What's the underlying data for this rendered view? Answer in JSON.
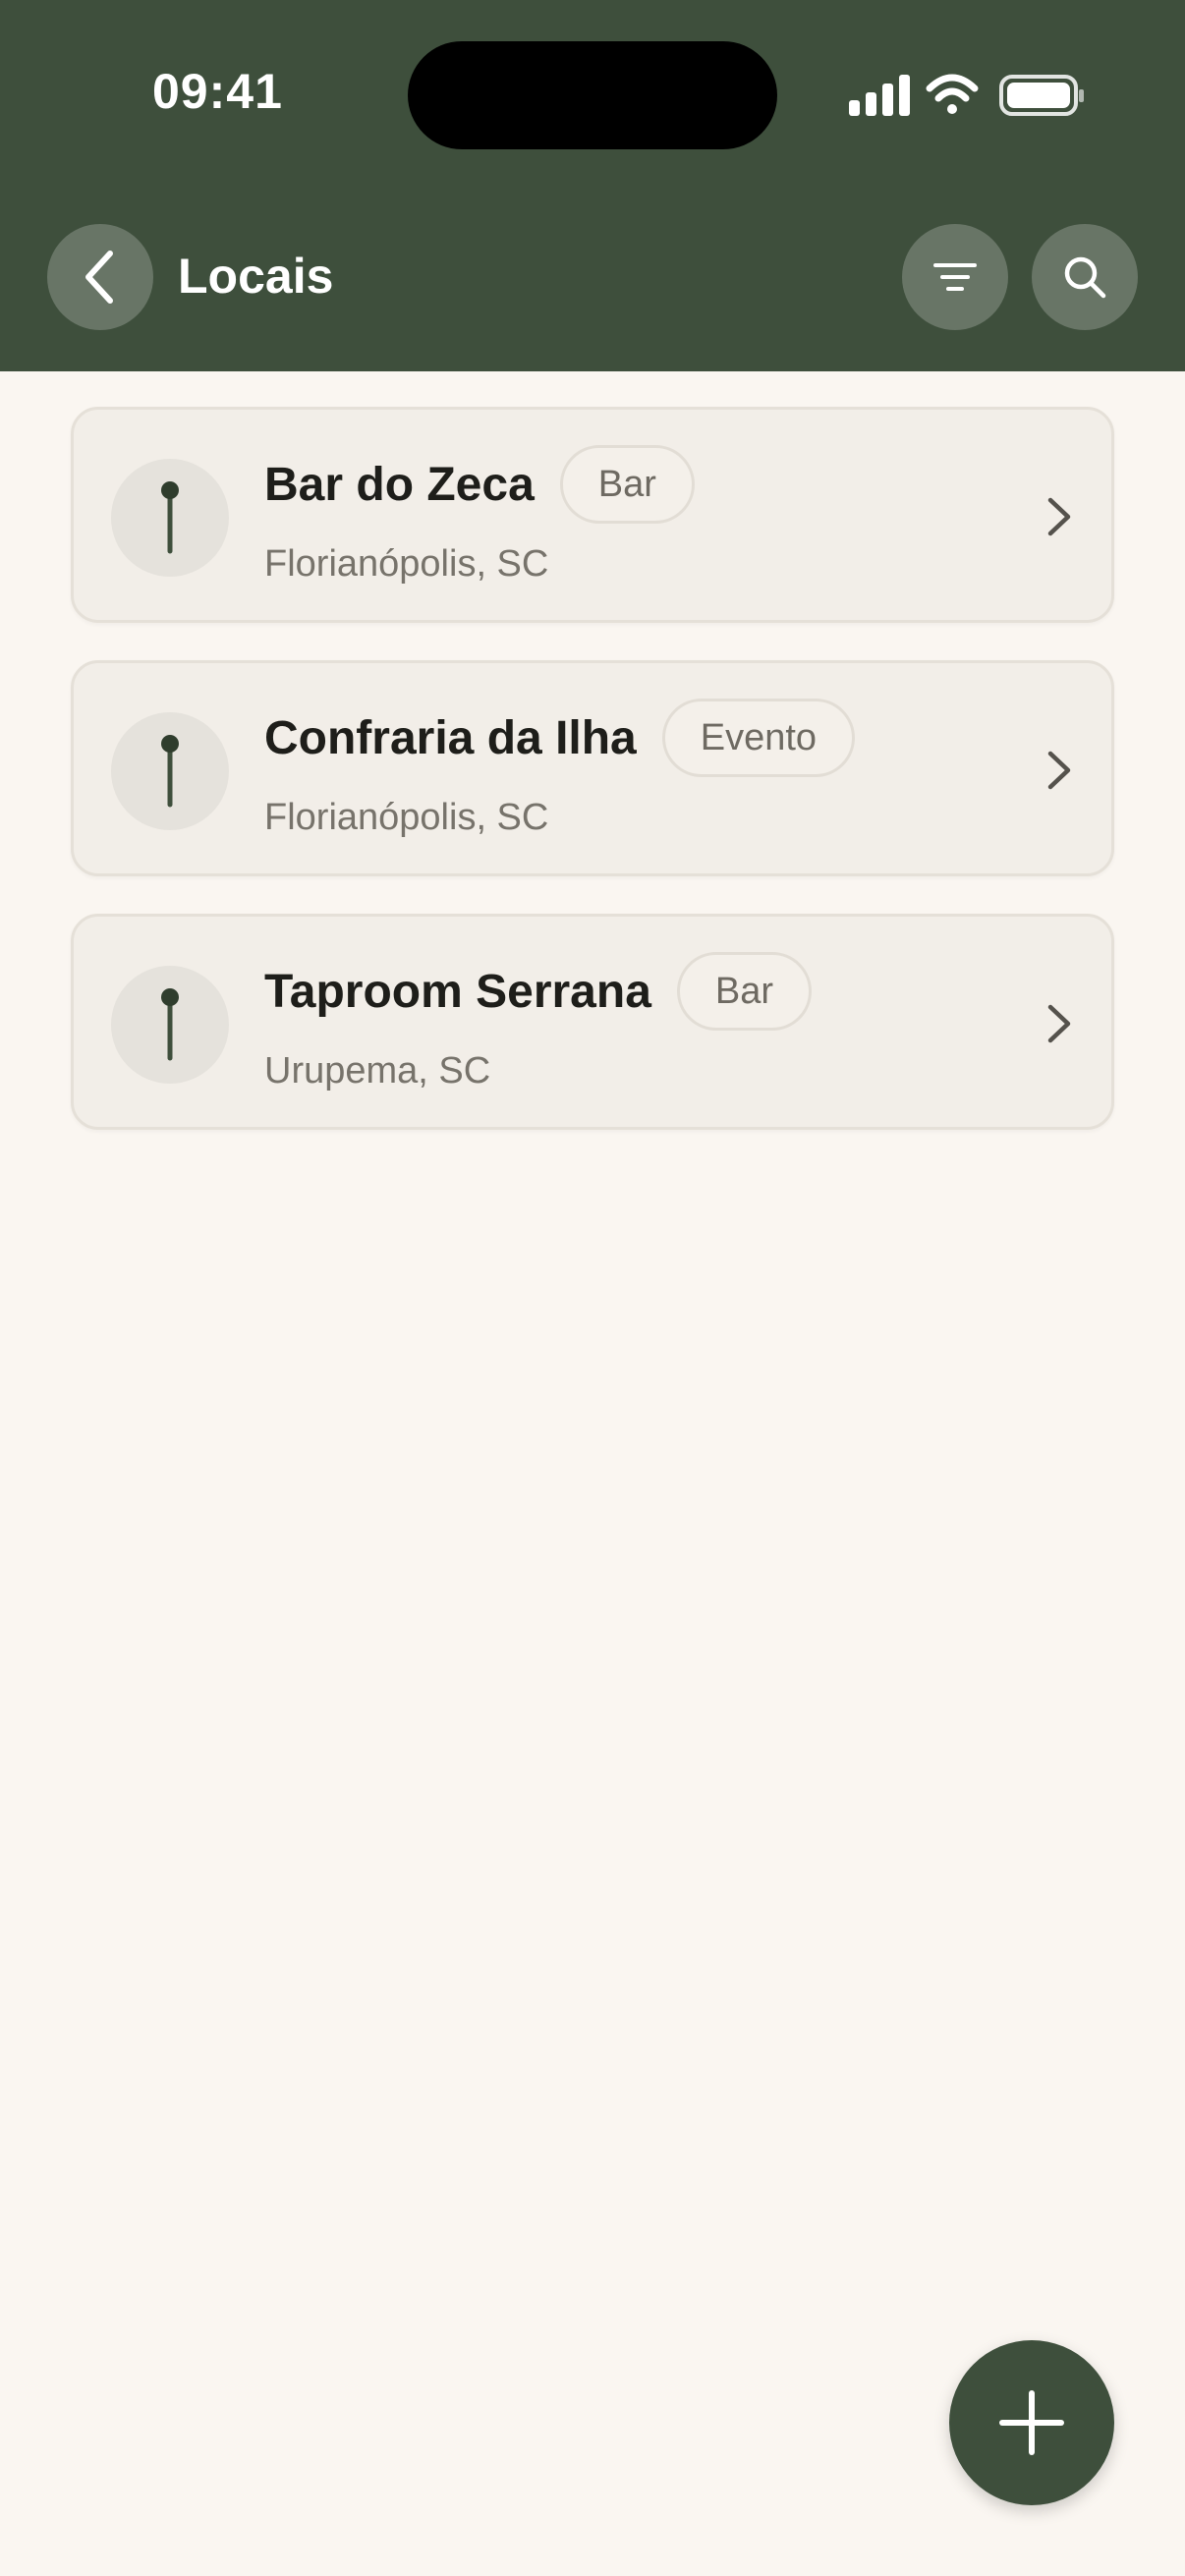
{
  "status_bar": {
    "time": "09:41"
  },
  "header": {
    "title": "Locais"
  },
  "icons": {
    "back": "chevron-left-icon",
    "filter": "filter-icon",
    "search": "search-icon",
    "pin": "pin-icon",
    "chevron": "chevron-right-icon",
    "add": "plus-icon"
  },
  "colors": {
    "brand": "#3e4f3c",
    "background": "#faf6f1",
    "card": "#f2eee8"
  },
  "places": [
    {
      "name": "Bar do Zeca",
      "type": "Bar",
      "location": "Florianópolis, SC"
    },
    {
      "name": "Confraria da Ilha",
      "type": "Evento",
      "location": "Florianópolis, SC"
    },
    {
      "name": "Taproom Serrana",
      "type": "Bar",
      "location": "Urupema, SC"
    }
  ]
}
